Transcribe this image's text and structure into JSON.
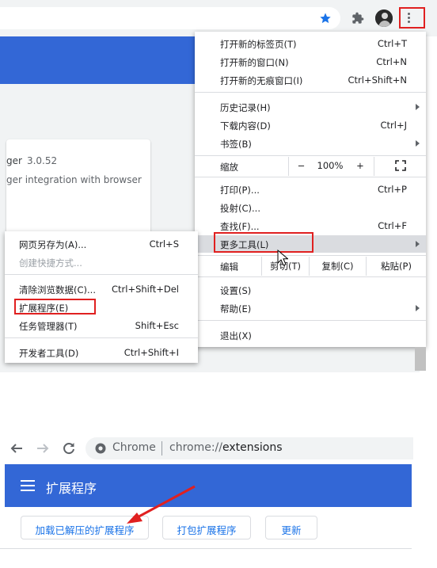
{
  "top_panel": {
    "extension_card": {
      "name_fragment": "ger",
      "version": "3.0.52",
      "description_fragment": "ger integration with browser"
    },
    "main_menu": {
      "items_group1": [
        {
          "label": "打开新的标签页(T)",
          "shortcut": "Ctrl+T"
        },
        {
          "label": "打开新的窗口(N)",
          "shortcut": "Ctrl+N"
        },
        {
          "label": "打开新的无痕窗口(I)",
          "shortcut": "Ctrl+Shift+N"
        }
      ],
      "items_group2": [
        {
          "label": "历史记录(H)",
          "shortcut": ""
        },
        {
          "label": "下载内容(D)",
          "shortcut": "Ctrl+J"
        },
        {
          "label": "书签(B)",
          "shortcut": ""
        }
      ],
      "zoom": {
        "label": "缩放",
        "minus": "−",
        "value": "100%",
        "plus": "+"
      },
      "items_group3": [
        {
          "label": "打印(P)...",
          "shortcut": "Ctrl+P"
        },
        {
          "label": "投射(C)...",
          "shortcut": ""
        },
        {
          "label": "查找(F)...",
          "shortcut": "Ctrl+F"
        },
        {
          "label": "更多工具(L)",
          "shortcut": ""
        }
      ],
      "edit": {
        "label": "编辑",
        "cut": "剪切(T)",
        "copy": "复制(C)",
        "paste": "粘贴(P)"
      },
      "items_group4": [
        {
          "label": "设置(S)",
          "shortcut": ""
        },
        {
          "label": "帮助(E)",
          "shortcut": ""
        }
      ],
      "exit": {
        "label": "退出(X)"
      }
    },
    "sub_menu": {
      "items_group1": [
        {
          "label": "网页另存为(A)...",
          "shortcut": "Ctrl+S"
        },
        {
          "label": "创建快捷方式...",
          "shortcut": ""
        }
      ],
      "items_group2": [
        {
          "label": "清除浏览数据(C)...",
          "shortcut": "Ctrl+Shift+Del"
        },
        {
          "label": "扩展程序(E)",
          "shortcut": ""
        },
        {
          "label": "任务管理器(T)",
          "shortcut": "Shift+Esc"
        }
      ],
      "items_group3": [
        {
          "label": "开发者工具(D)",
          "shortcut": "Ctrl+Shift+I"
        }
      ]
    }
  },
  "bottom_panel": {
    "url": {
      "host": "Chrome",
      "scheme": "chrome://",
      "path": "extensions"
    },
    "header_title": "扩展程序",
    "buttons": {
      "load_unpacked": "加载已解压的扩展程序",
      "pack": "打包扩展程序",
      "update": "更新"
    }
  },
  "colors": {
    "highlight_box": "#e02020",
    "chrome_blue": "#3367d6",
    "link_blue": "#1a73e8"
  }
}
